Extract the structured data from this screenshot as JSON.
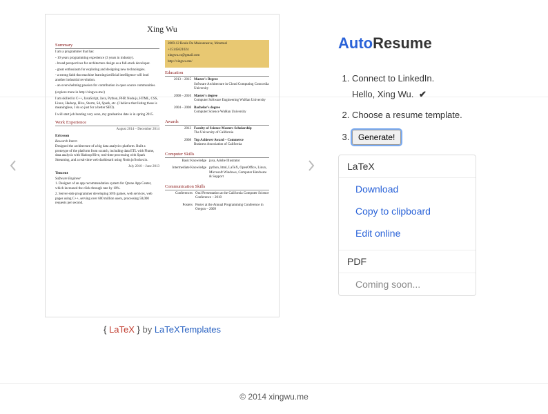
{
  "logo": {
    "part1": "Auto",
    "part2": "Resume"
  },
  "steps": {
    "step1": "Connect to LinkedIn.",
    "hello": "Hello, Xing Wu.",
    "step2": "Choose a resume template.",
    "step3_button": "Generate!"
  },
  "output_box": {
    "latex_header": "LaTeX",
    "download": "Download",
    "copy": "Copy to clipboard",
    "edit": "Edit online",
    "pdf_header": "PDF",
    "coming": "Coming soon..."
  },
  "credits": {
    "open": "{ ",
    "latex": "LaTeX",
    "close": " }",
    "by": " by ",
    "link": "LaTeXTemplates"
  },
  "footer": "© 2014 xingwu.me",
  "resume": {
    "name": "Xing Wu",
    "contact": {
      "address": "2069-12 Boule De Maisonneuve, Montreal",
      "phone": "+15145621024",
      "email": "xingwu.cs@gmail.com",
      "web": "http://xingwu.me/"
    },
    "sections": {
      "summary": "Summary",
      "work": "Work Experience",
      "education": "Education",
      "awards": "Awards",
      "computer": "Computer Skills",
      "comm": "Communication Skills"
    },
    "summary_lines": {
      "l1": "I am a programmer that has:",
      "l2": "- 10 years programming experience (3 years in industry).",
      "l3": "- broad perspectives for architecture design as a full-stack developer.",
      "l4": "- great enthusiasm for exploring and designing new technologies.",
      "l5": "- a strong faith that machine learning/artificial intelligence will lead another industrial revolution.",
      "l6": "- an overwhelming passion for contribution in open source communities.",
      "l7": "(explore more in http://xingwu.me/)",
      "l8": "I am skilled in C++, JavaScript, Java, Python, PHP, Node.js, HTML, CSS, Linux, Hadoop, Hive, Storm, S4, Spark, etc. (I believe that listing these is meaningless, I do so just for a better SEO).",
      "l9": "I will start job hunting very soon, my graduation date is in spring 2015."
    },
    "work": {
      "w1_dates": "August 2014 – December 2014",
      "w1_company": "Ericsson",
      "w1_role": "Research Intern",
      "w1_desc": "Designed the architecture of a big data analytics platform. Built a prototype of the platform from scratch, including data ETL with Flume, data analysis with Hadoop/Hive, real-time processing with Spark Streaming, and a real-time web dashboard using Node.js/Socket.io.",
      "w2_dates": "July 2010 – June 2013",
      "w2_company": "Tencent",
      "w2_role": "Software Engineer",
      "w2_desc1": "1. Designer of an app recommendation system for Qzone App Center, which increased the click-through rate by 10%.",
      "w2_desc2": "2. Server-side programmer developing SNS games, web services, web pages using C++, serving over 600 million users, processing 50,000 requests per second."
    },
    "education": {
      "e1_date": "2013 – 2015",
      "e1_title": "Master's Degree",
      "e1_sub": "Software Architecture in Cloud Computing\nConcordia University",
      "e2_date": "2008 – 2010",
      "e2_title": "Master's degree",
      "e2_sub": "Computer Software Engineering\nWuHan University",
      "e3_date": "2004 – 2008",
      "e3_title": "Bachelor's degree",
      "e3_sub": "Computer Science\nWuHan University"
    },
    "awards": {
      "a1_date": "2013",
      "a1_title": "Faculty of Science Masters Scholarship",
      "a1_sub": "The University of California",
      "a2_date": "2008",
      "a2_title": "Top Achiever Award – Commerce",
      "a2_sub": "Business Association of California"
    },
    "computer": {
      "c1_label": "Basic Knowledge",
      "c1_val": "java, Adobe Illustrator",
      "c2_label": "Intermediate Knowledge",
      "c2_val": "python, html, LaTeX, OpenOffice, Linux, Microsoft Windows, Computer Hardware & Support"
    },
    "comm": {
      "m1_label": "Conferences",
      "m1_val": "Oral Presentation at the California Computer Science Conference – 2010",
      "m2_label": "Posters",
      "m2_val": "Poster at the Annual Programming Conference in Oregon – 2009"
    }
  }
}
